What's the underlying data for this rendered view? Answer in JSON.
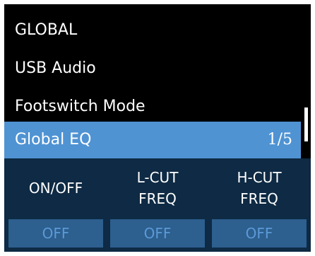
{
  "menu": {
    "items": [
      {
        "label": "GLOBAL"
      },
      {
        "label": "USB Audio"
      },
      {
        "label": "Footswitch Mode"
      },
      {
        "label": "Global EQ",
        "page": "1/5"
      }
    ]
  },
  "params": [
    {
      "label": "ON/OFF",
      "value": "OFF"
    },
    {
      "label": "L-CUT\nFREQ",
      "value": "OFF"
    },
    {
      "label": "H-CUT\nFREQ",
      "value": "OFF"
    }
  ],
  "colors": {
    "background": "#000000",
    "selected": "#4f93d3",
    "panel": "#0e2a44",
    "value_box": "#2d5f8f",
    "value_text": "#5b9ad6"
  }
}
